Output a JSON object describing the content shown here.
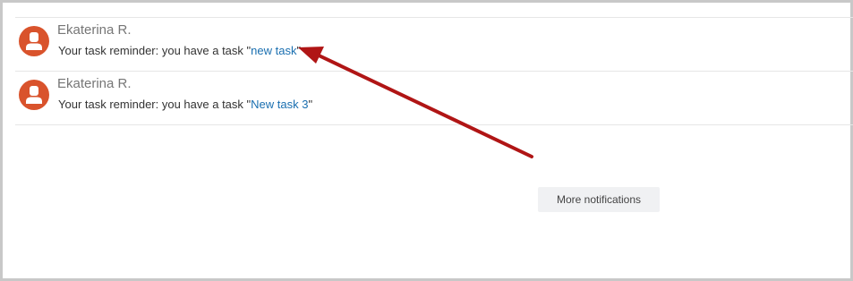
{
  "notifications": [
    {
      "author": "Ekaterina R.",
      "message_prefix": "Your task reminder: you have a task ",
      "quote_open": "\"",
      "task_link": "new task",
      "quote_close": "\"",
      "avatar_icon": "user-avatar-icon"
    },
    {
      "author": "Ekaterina R.",
      "message_prefix": "Your task reminder: you have a task ",
      "quote_open": "\"",
      "task_link": "New task 3",
      "quote_close": "\"",
      "avatar_icon": "user-avatar-icon"
    }
  ],
  "more_button_label": "More notifications",
  "colors": {
    "avatar": "#d9532c",
    "link": "#1a6fb0",
    "arrow": "#b01515"
  }
}
